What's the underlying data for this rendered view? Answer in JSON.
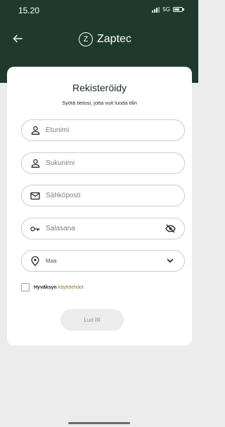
{
  "status_bar": {
    "time": "15.20",
    "network": "5G"
  },
  "header": {
    "brand": "Zaptec",
    "logo_letter": "Z"
  },
  "form": {
    "title": "Rekisteröidy",
    "subtitle": "Syötä tietosi, jotta voit luoda tilin",
    "fields": {
      "first_name": {
        "placeholder": "Etunimi",
        "icon": "person-icon"
      },
      "last_name": {
        "placeholder": "Sukunimi",
        "icon": "person-icon"
      },
      "email": {
        "placeholder": "Sähköposti",
        "icon": "mail-icon"
      },
      "password": {
        "placeholder": "Salasana",
        "icon": "key-icon",
        "toggle_icon": "eye-off-icon"
      },
      "country": {
        "value": "Maa",
        "icon": "location-pin-icon",
        "dropdown_icon": "chevron-down-icon"
      }
    },
    "terms": {
      "text": "Hyväksyn",
      "link": "käyttöehdot",
      "checked": false
    },
    "submit_label": "Luo tili"
  },
  "colors": {
    "header_bg": "#1f3a2c",
    "page_bg": "#ececec",
    "card_bg": "#ffffff",
    "link": "#8a7c2e",
    "button_disabled_bg": "#ececec"
  }
}
